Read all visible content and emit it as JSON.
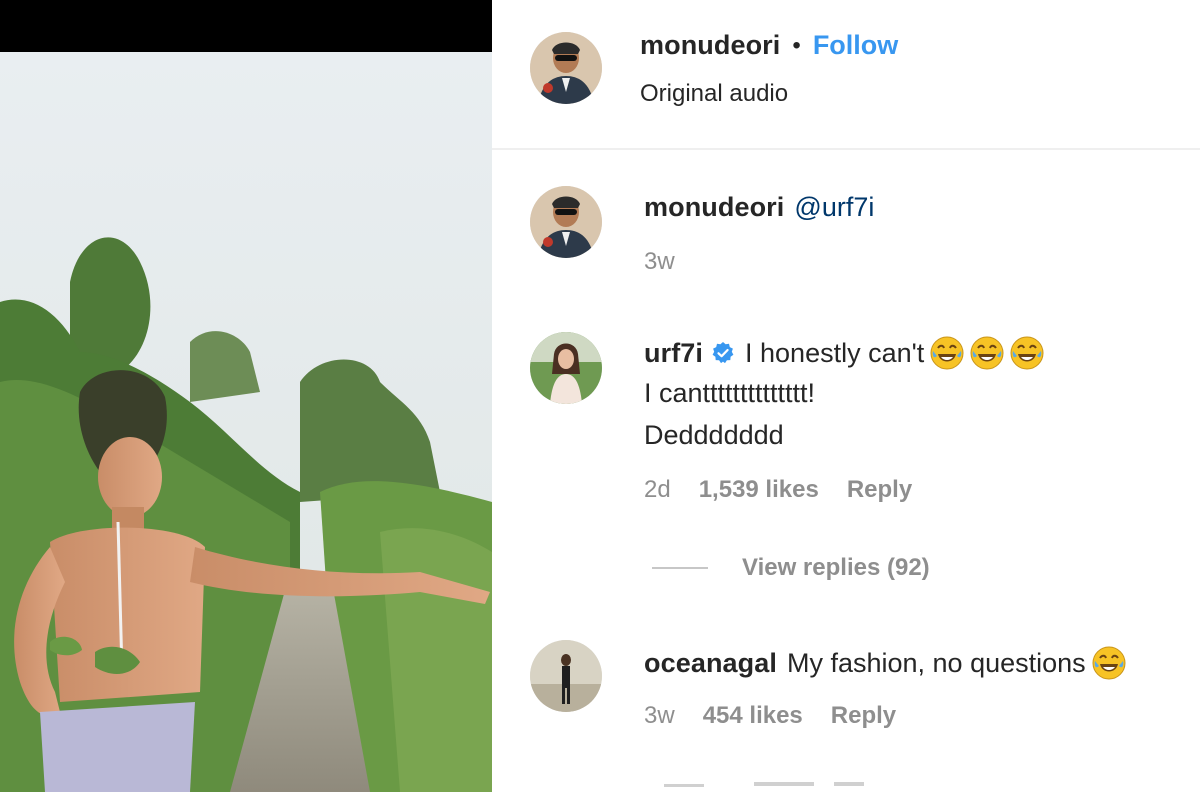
{
  "post": {
    "username": "monudeori",
    "separator": "•",
    "follow_label": "Follow",
    "audio": "Original audio"
  },
  "comments": [
    {
      "username": "monudeori",
      "mention": "@urf7i",
      "time": "3w"
    },
    {
      "username": "urf7i",
      "verified": true,
      "lines": [
        "I honestly can't",
        "I cantttttttttttttt!",
        "Deddddddd"
      ],
      "emoji": [
        "face-with-tears-of-joy",
        "face-with-tears-of-joy",
        "face-with-tears-of-joy"
      ],
      "time": "2d",
      "likes": "1,539 likes",
      "reply_label": "Reply",
      "view_replies": "View replies (92)"
    },
    {
      "username": "oceanagal",
      "text": "My fashion, no questions",
      "emoji": [
        "face-with-tears-of-joy"
      ],
      "time": "3w",
      "likes": "454 likes",
      "reply_label": "Reply"
    }
  ],
  "colors": {
    "link_blue": "#3897f0",
    "mention_blue": "#00376b",
    "meta_gray": "#8e8e8e",
    "text": "#262626",
    "verified_blue": "#3897f0"
  }
}
